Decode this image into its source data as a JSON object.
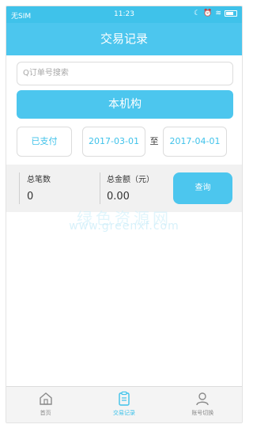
{
  "status_bar": {
    "carrier": "无SIM",
    "time": "11:23"
  },
  "header": {
    "title": "交易记录"
  },
  "search": {
    "placeholder": "Q订单号搜索"
  },
  "institution_button": {
    "label": "本机构"
  },
  "filters": {
    "status": "已支付",
    "start_date": "2017-03-01",
    "to_label": "至",
    "end_date": "2017-04-01"
  },
  "summary": {
    "count_label": "总笔数",
    "count_value": "0",
    "amount_label": "总金额（元）",
    "amount_value": "0.00",
    "query_button": "查询"
  },
  "watermark": {
    "cn": "绿色资源网",
    "url": "www.greenxf.com"
  },
  "tab_bar": {
    "items": [
      {
        "label": "首页",
        "icon": "home-icon"
      },
      {
        "label": "交易记录",
        "icon": "clipboard-icon",
        "active": true
      },
      {
        "label": "账号切换",
        "icon": "user-icon"
      }
    ]
  },
  "colors": {
    "accent": "#4cc6ee",
    "summary_bg": "#f1f1f1"
  }
}
